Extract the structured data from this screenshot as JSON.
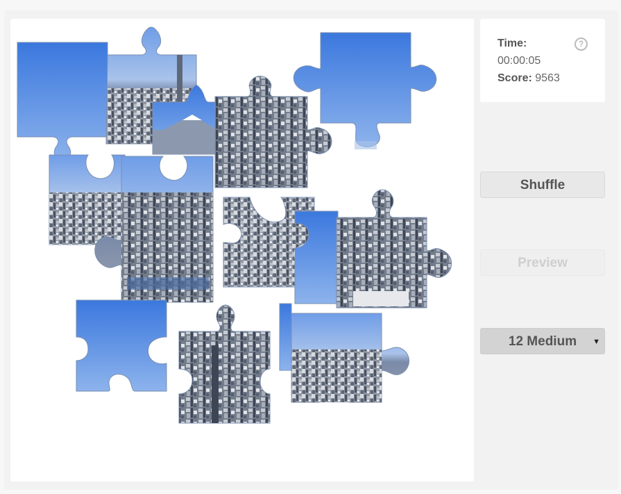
{
  "info": {
    "time_label": "Time:",
    "time_value": "00:00:05",
    "score_label": "Score:",
    "score_value": "9563",
    "help_symbol": "?"
  },
  "buttons": {
    "shuffle": "Shuffle",
    "preview": "Preview"
  },
  "level_select": {
    "selected": "12 Medium",
    "caret": "▼"
  },
  "colors": {
    "sky_top": "#3f7fe0",
    "sky_bottom": "#8fb6ee",
    "city_dark": "#4a5568",
    "city_light": "#c9cdd3",
    "piece_border": "#8a8a8a"
  },
  "puzzle": {
    "piece_count": 12,
    "icons": [
      "sky-piece-icon",
      "city-piece-icon",
      "mixed-piece-icon"
    ]
  }
}
